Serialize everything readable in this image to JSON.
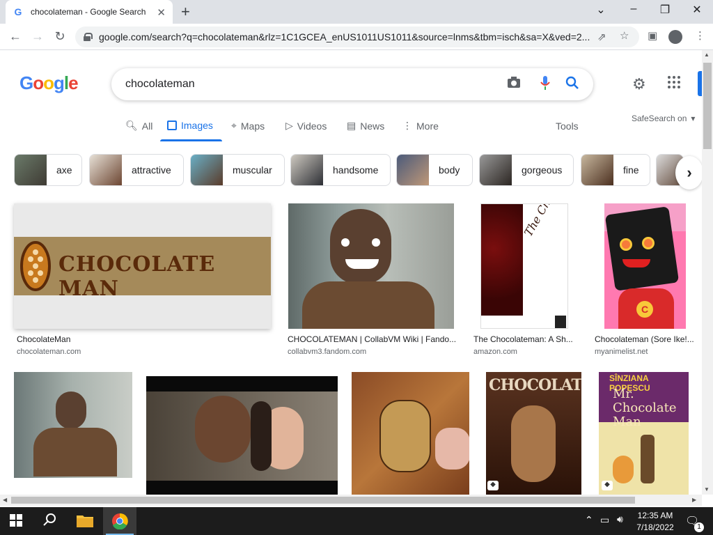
{
  "browser": {
    "tab_title": "chocolateman - Google Search",
    "url": "google.com/search?q=chocolateman&rlz=1C1GCEA_enUS1011US1011&source=lnms&tbm=isch&sa=X&ved=2..."
  },
  "search": {
    "logo": "Google",
    "query": "chocolateman"
  },
  "tabs": [
    "All",
    "Images",
    "Maps",
    "Videos",
    "News",
    "More"
  ],
  "tools_label": "Tools",
  "safesearch_label": "SafeSearch on",
  "chips": [
    "axe",
    "attractive",
    "muscular",
    "handsome",
    "body",
    "gorgeous",
    "fine"
  ],
  "results_row1": [
    {
      "title": "ChocolateMan",
      "source": "chocolateman.com",
      "logo_text": "CHOCOLATE MAN"
    },
    {
      "title": "CHOCOLATEMAN | CollabVM Wiki | Fando...",
      "source": "collabvm3.fandom.com"
    },
    {
      "title": "The Chocolateman: A Sh...",
      "source": "amazon.com",
      "cover_text": "The Chocolateman"
    },
    {
      "title": "Chocolateman (Sore Ike!...",
      "source": "myanimelist.net"
    }
  ],
  "results_row2": [
    {
      "cover_text": "CHOCOLATEMAN"
    },
    {
      "author_text": "SÎNZIANA POPESCU",
      "cover_text": "Mr. Chocolate Man"
    }
  ],
  "taskbar": {
    "time": "12:35 AM",
    "date": "7/18/2022",
    "notification_count": "1"
  },
  "colors": {
    "accent": "#1a73e8",
    "taskbar": "#1c1c1c"
  }
}
